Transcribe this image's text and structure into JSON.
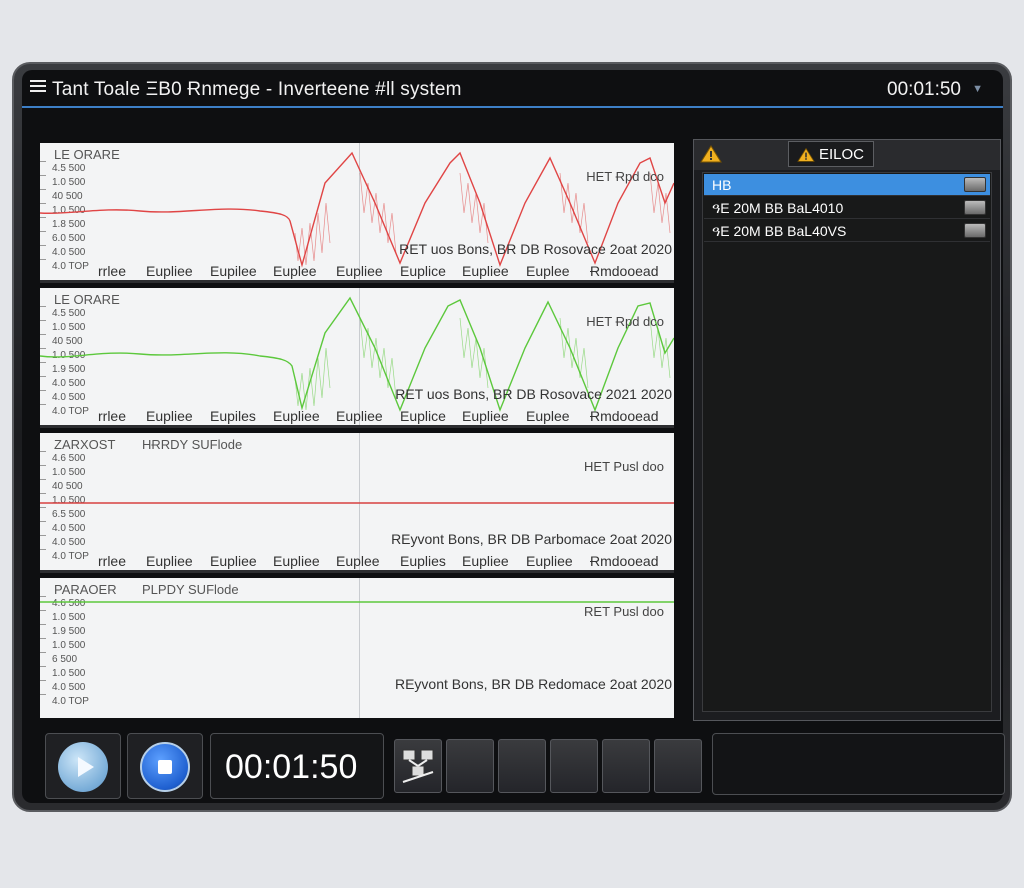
{
  "window": {
    "title": "Tant Toale ΞΒ0 Ɍnmege - Inverteene #ll system",
    "clock": "00:01:50"
  },
  "colors": {
    "accent": "#3d7fc6",
    "red_trace": "#e04545",
    "green_trace": "#5cc83c",
    "selected_row": "#3d8fe0"
  },
  "panels": [
    {
      "label": "LE ORARE",
      "sublabel": "",
      "right_text": "HET Ɍpd dco",
      "status": "RET uos Bons, BR DB Rosovace 2oat 2020",
      "yticks": [
        "4.5 500",
        "1.0 500",
        "40 500",
        "1.0 500",
        "1.8 500",
        "6.0 500",
        "4.0 500",
        "4.0 TOP"
      ],
      "axis": [
        "rrlee",
        "Eupliee",
        "Eupilee",
        "Euplee",
        "Eupliee",
        "Euplice",
        "Eupliee",
        "Euplee",
        "Ɍmdooead"
      ],
      "trace_color": "red"
    },
    {
      "label": "LE ORARE",
      "sublabel": "",
      "right_text": "HET Ɍpd dco",
      "status": "RET uos Bons, BR DB Rosovace 2021 2020",
      "yticks": [
        "4.5 500",
        "1.0 500",
        "40 500",
        "1.0 500",
        "1.9 500",
        "4.0 500",
        "4.0 500",
        "4.0 TOP"
      ],
      "axis": [
        "rrlee",
        "Eupliee",
        "Eupiles",
        "Eupliee",
        "Eupliee",
        "Euplice",
        "Eupliee",
        "Euplee",
        "Ɍmdooead"
      ],
      "trace_color": "green"
    },
    {
      "label": "ZARXOST",
      "sublabel": "HɌRDY SUFlode",
      "right_text": "HET Pusl doo",
      "status": "REyvont Bons, BR DB Parbomace 2oat 2020",
      "yticks": [
        "4.6 500",
        "1.0 500",
        "40 500",
        "1.0 500",
        "6.5 500",
        "4.0 500",
        "4.0 500",
        "4.0 TOP"
      ],
      "axis": [
        "rrlee",
        "Eupliee",
        "Eupliee",
        "Eupliee",
        "Euplee",
        "Euplies",
        "Eupliee",
        "Eupliee",
        "Ɍmdooead"
      ],
      "trace_color": "red"
    },
    {
      "label": "PARAOER",
      "sublabel": "PLPDY SUFlode",
      "right_text": "RET Pusl doo",
      "status": "REyvont Bons, BR DB Redomace 2oat 2020",
      "yticks": [
        "4.6 500",
        "1.0 500",
        "1.9 500",
        "1.0 500",
        "6 500",
        "1.0 500",
        "4.0 500",
        "4.0 TOP"
      ],
      "axis": [],
      "trace_color": "green"
    }
  ],
  "side": {
    "button_label": "EILOC",
    "rows": [
      {
        "label": "HB",
        "selected": true
      },
      {
        "label": "ዓE 20M ΒB ΒaL4010",
        "selected": false
      },
      {
        "label": "ዓE 20M ΒB ΒaL40VS",
        "selected": false
      }
    ]
  },
  "controls": {
    "play_icon": "play-icon",
    "stop_icon": "stop-icon",
    "time": "00:01:50",
    "tool_icon": "network-tool-icon"
  }
}
